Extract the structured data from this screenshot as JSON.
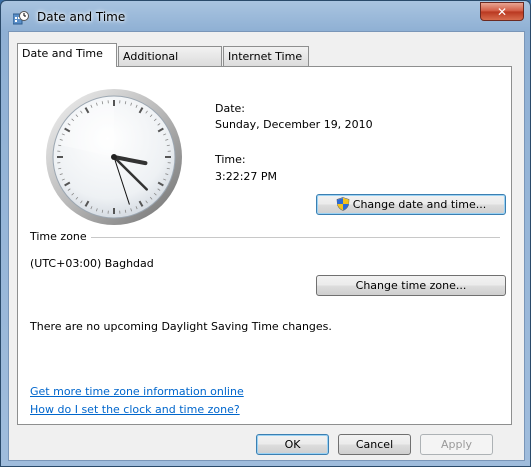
{
  "window": {
    "title": "Date and Time",
    "close_glyph": "✕"
  },
  "tabs": [
    {
      "label": "Date and Time",
      "active": true
    },
    {
      "label": "Additional Clocks",
      "active": false
    },
    {
      "label": "Internet Time",
      "active": false
    }
  ],
  "datetime": {
    "date_label": "Date:",
    "date_value": "Sunday, December 19, 2010",
    "time_label": "Time:",
    "time_value": "3:22:27 PM",
    "change_datetime_button": "Change date and time..."
  },
  "timezone": {
    "section_label": "Time zone",
    "value": "(UTC+03:00) Baghdad",
    "change_timezone_button": "Change time zone...",
    "dst_message": "There are no upcoming Daylight Saving Time changes."
  },
  "links": {
    "more_info": "Get more time zone information online",
    "how_to_set": "How do I set the clock and time zone?"
  },
  "footer": {
    "ok": "OK",
    "cancel": "Cancel",
    "apply": "Apply"
  },
  "clock": {
    "hour": 3,
    "minute": 22,
    "second": 27
  },
  "colors": {
    "link": "#0066cc",
    "default_button_border": "#3c7fb1"
  },
  "icons": {
    "window": "datetime-app-icon",
    "close": "close-icon",
    "shield": "uac-shield-icon"
  }
}
